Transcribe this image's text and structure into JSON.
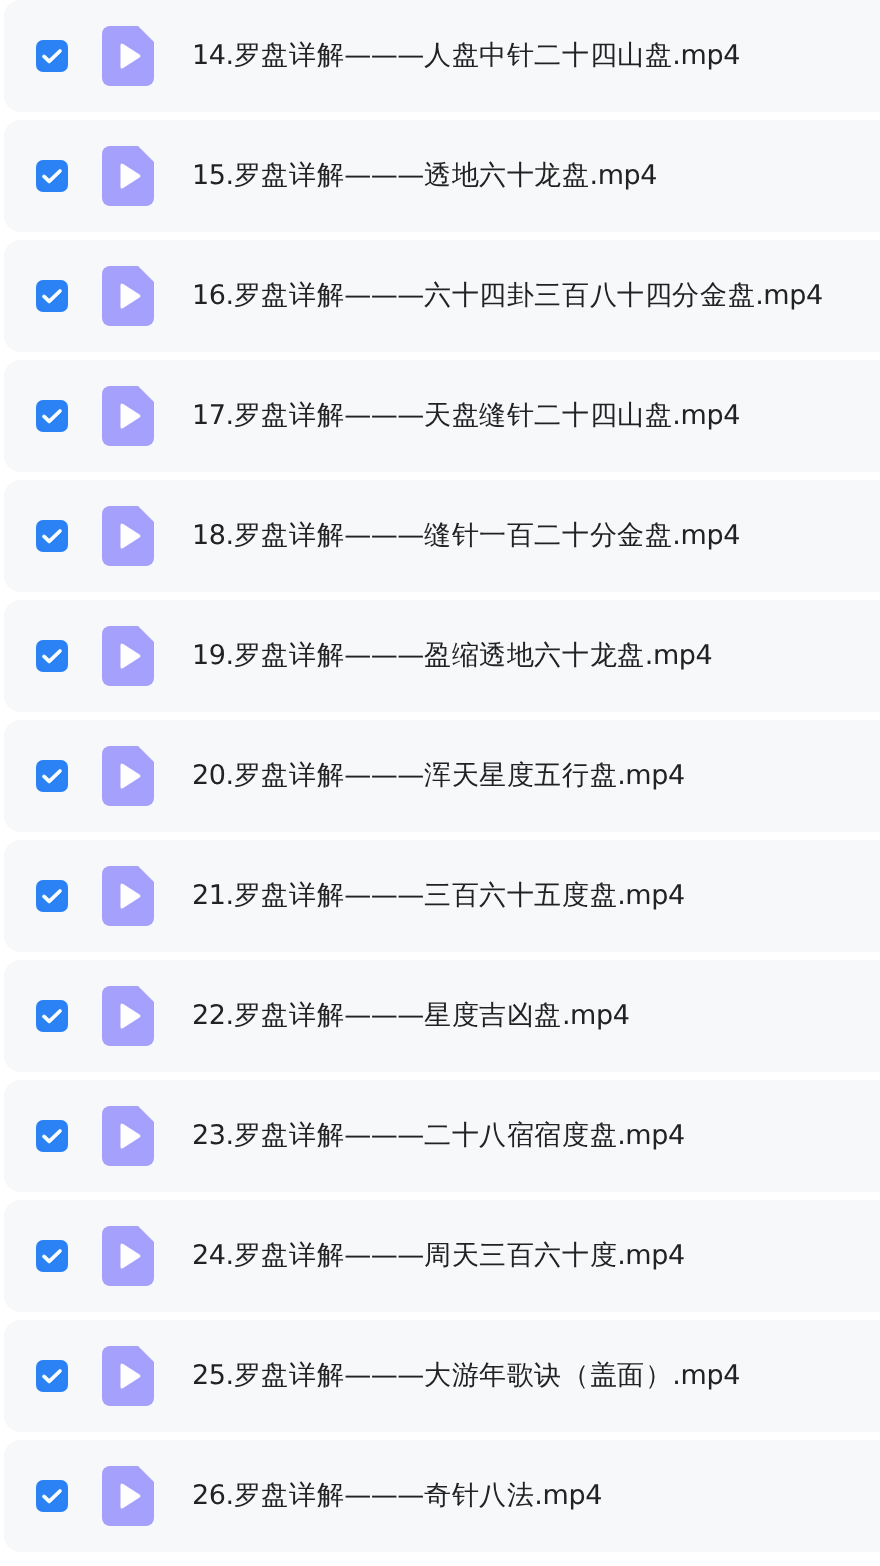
{
  "files": [
    {
      "name": "14.罗盘详解———人盘中针二十四山盘.mp4",
      "checked": true
    },
    {
      "name": "15.罗盘详解———透地六十龙盘.mp4",
      "checked": true
    },
    {
      "name": "16.罗盘详解———六十四卦三百八十四分金盘.mp4",
      "checked": true
    },
    {
      "name": "17.罗盘详解———天盘缝针二十四山盘.mp4",
      "checked": true
    },
    {
      "name": "18.罗盘详解———缝针一百二十分金盘.mp4",
      "checked": true
    },
    {
      "name": "19.罗盘详解———盈缩透地六十龙盘.mp4",
      "checked": true
    },
    {
      "name": "20.罗盘详解———浑天星度五行盘.mp4",
      "checked": true
    },
    {
      "name": "21.罗盘详解———三百六十五度盘.mp4",
      "checked": true
    },
    {
      "name": "22.罗盘详解———星度吉凶盘.mp4",
      "checked": true
    },
    {
      "name": "23.罗盘详解———二十八宿宿度盘.mp4",
      "checked": true
    },
    {
      "name": "24.罗盘详解———周天三百六十度.mp4",
      "checked": true
    },
    {
      "name": "25.罗盘详解———大游年歌诀（盖面）.mp4",
      "checked": true
    },
    {
      "name": "26.罗盘详解———奇针八法.mp4",
      "checked": true
    }
  ]
}
